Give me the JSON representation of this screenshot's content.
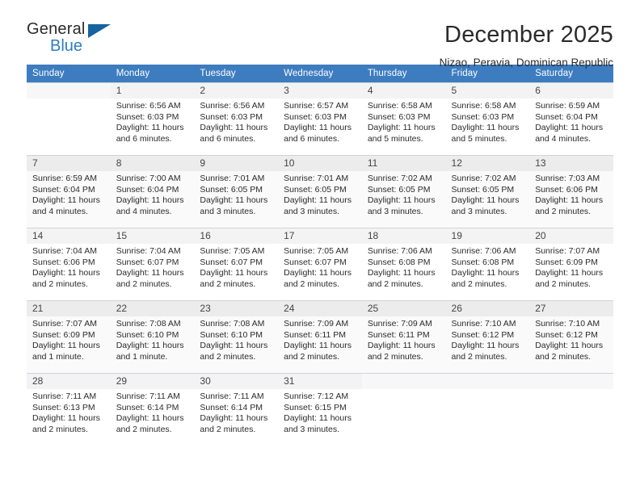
{
  "logo": {
    "word_top": "General",
    "word_bottom": "Blue",
    "triangle_color": "#15639f",
    "blue_color": "#2b7dc3"
  },
  "header": {
    "title": "December 2025",
    "location": "Nizao, Peravia, Dominican Republic"
  },
  "colors": {
    "header_row_bg": "#3d7cbf",
    "header_row_text": "#ffffff",
    "daynum_bg": "#f0f0f0",
    "grid_line": "#c8d4e2",
    "text": "#2b2b2b"
  },
  "weekday_headers": [
    "Sunday",
    "Monday",
    "Tuesday",
    "Wednesday",
    "Thursday",
    "Friday",
    "Saturday"
  ],
  "weeks": [
    {
      "days": [
        {
          "num": "",
          "sunrise": "",
          "sunset": "",
          "daylight_line1": "",
          "daylight_line2": ""
        },
        {
          "num": "1",
          "sunrise": "Sunrise: 6:56 AM",
          "sunset": "Sunset: 6:03 PM",
          "daylight_line1": "Daylight: 11 hours",
          "daylight_line2": "and 6 minutes."
        },
        {
          "num": "2",
          "sunrise": "Sunrise: 6:56 AM",
          "sunset": "Sunset: 6:03 PM",
          "daylight_line1": "Daylight: 11 hours",
          "daylight_line2": "and 6 minutes."
        },
        {
          "num": "3",
          "sunrise": "Sunrise: 6:57 AM",
          "sunset": "Sunset: 6:03 PM",
          "daylight_line1": "Daylight: 11 hours",
          "daylight_line2": "and 6 minutes."
        },
        {
          "num": "4",
          "sunrise": "Sunrise: 6:58 AM",
          "sunset": "Sunset: 6:03 PM",
          "daylight_line1": "Daylight: 11 hours",
          "daylight_line2": "and 5 minutes."
        },
        {
          "num": "5",
          "sunrise": "Sunrise: 6:58 AM",
          "sunset": "Sunset: 6:03 PM",
          "daylight_line1": "Daylight: 11 hours",
          "daylight_line2": "and 5 minutes."
        },
        {
          "num": "6",
          "sunrise": "Sunrise: 6:59 AM",
          "sunset": "Sunset: 6:04 PM",
          "daylight_line1": "Daylight: 11 hours",
          "daylight_line2": "and 4 minutes."
        }
      ]
    },
    {
      "days": [
        {
          "num": "7",
          "sunrise": "Sunrise: 6:59 AM",
          "sunset": "Sunset: 6:04 PM",
          "daylight_line1": "Daylight: 11 hours",
          "daylight_line2": "and 4 minutes."
        },
        {
          "num": "8",
          "sunrise": "Sunrise: 7:00 AM",
          "sunset": "Sunset: 6:04 PM",
          "daylight_line1": "Daylight: 11 hours",
          "daylight_line2": "and 4 minutes."
        },
        {
          "num": "9",
          "sunrise": "Sunrise: 7:01 AM",
          "sunset": "Sunset: 6:05 PM",
          "daylight_line1": "Daylight: 11 hours",
          "daylight_line2": "and 3 minutes."
        },
        {
          "num": "10",
          "sunrise": "Sunrise: 7:01 AM",
          "sunset": "Sunset: 6:05 PM",
          "daylight_line1": "Daylight: 11 hours",
          "daylight_line2": "and 3 minutes."
        },
        {
          "num": "11",
          "sunrise": "Sunrise: 7:02 AM",
          "sunset": "Sunset: 6:05 PM",
          "daylight_line1": "Daylight: 11 hours",
          "daylight_line2": "and 3 minutes."
        },
        {
          "num": "12",
          "sunrise": "Sunrise: 7:02 AM",
          "sunset": "Sunset: 6:05 PM",
          "daylight_line1": "Daylight: 11 hours",
          "daylight_line2": "and 3 minutes."
        },
        {
          "num": "13",
          "sunrise": "Sunrise: 7:03 AM",
          "sunset": "Sunset: 6:06 PM",
          "daylight_line1": "Daylight: 11 hours",
          "daylight_line2": "and 2 minutes."
        }
      ]
    },
    {
      "days": [
        {
          "num": "14",
          "sunrise": "Sunrise: 7:04 AM",
          "sunset": "Sunset: 6:06 PM",
          "daylight_line1": "Daylight: 11 hours",
          "daylight_line2": "and 2 minutes."
        },
        {
          "num": "15",
          "sunrise": "Sunrise: 7:04 AM",
          "sunset": "Sunset: 6:07 PM",
          "daylight_line1": "Daylight: 11 hours",
          "daylight_line2": "and 2 minutes."
        },
        {
          "num": "16",
          "sunrise": "Sunrise: 7:05 AM",
          "sunset": "Sunset: 6:07 PM",
          "daylight_line1": "Daylight: 11 hours",
          "daylight_line2": "and 2 minutes."
        },
        {
          "num": "17",
          "sunrise": "Sunrise: 7:05 AM",
          "sunset": "Sunset: 6:07 PM",
          "daylight_line1": "Daylight: 11 hours",
          "daylight_line2": "and 2 minutes."
        },
        {
          "num": "18",
          "sunrise": "Sunrise: 7:06 AM",
          "sunset": "Sunset: 6:08 PM",
          "daylight_line1": "Daylight: 11 hours",
          "daylight_line2": "and 2 minutes."
        },
        {
          "num": "19",
          "sunrise": "Sunrise: 7:06 AM",
          "sunset": "Sunset: 6:08 PM",
          "daylight_line1": "Daylight: 11 hours",
          "daylight_line2": "and 2 minutes."
        },
        {
          "num": "20",
          "sunrise": "Sunrise: 7:07 AM",
          "sunset": "Sunset: 6:09 PM",
          "daylight_line1": "Daylight: 11 hours",
          "daylight_line2": "and 2 minutes."
        }
      ]
    },
    {
      "days": [
        {
          "num": "21",
          "sunrise": "Sunrise: 7:07 AM",
          "sunset": "Sunset: 6:09 PM",
          "daylight_line1": "Daylight: 11 hours",
          "daylight_line2": "and 1 minute."
        },
        {
          "num": "22",
          "sunrise": "Sunrise: 7:08 AM",
          "sunset": "Sunset: 6:10 PM",
          "daylight_line1": "Daylight: 11 hours",
          "daylight_line2": "and 1 minute."
        },
        {
          "num": "23",
          "sunrise": "Sunrise: 7:08 AM",
          "sunset": "Sunset: 6:10 PM",
          "daylight_line1": "Daylight: 11 hours",
          "daylight_line2": "and 2 minutes."
        },
        {
          "num": "24",
          "sunrise": "Sunrise: 7:09 AM",
          "sunset": "Sunset: 6:11 PM",
          "daylight_line1": "Daylight: 11 hours",
          "daylight_line2": "and 2 minutes."
        },
        {
          "num": "25",
          "sunrise": "Sunrise: 7:09 AM",
          "sunset": "Sunset: 6:11 PM",
          "daylight_line1": "Daylight: 11 hours",
          "daylight_line2": "and 2 minutes."
        },
        {
          "num": "26",
          "sunrise": "Sunrise: 7:10 AM",
          "sunset": "Sunset: 6:12 PM",
          "daylight_line1": "Daylight: 11 hours",
          "daylight_line2": "and 2 minutes."
        },
        {
          "num": "27",
          "sunrise": "Sunrise: 7:10 AM",
          "sunset": "Sunset: 6:12 PM",
          "daylight_line1": "Daylight: 11 hours",
          "daylight_line2": "and 2 minutes."
        }
      ]
    },
    {
      "days": [
        {
          "num": "28",
          "sunrise": "Sunrise: 7:11 AM",
          "sunset": "Sunset: 6:13 PM",
          "daylight_line1": "Daylight: 11 hours",
          "daylight_line2": "and 2 minutes."
        },
        {
          "num": "29",
          "sunrise": "Sunrise: 7:11 AM",
          "sunset": "Sunset: 6:14 PM",
          "daylight_line1": "Daylight: 11 hours",
          "daylight_line2": "and 2 minutes."
        },
        {
          "num": "30",
          "sunrise": "Sunrise: 7:11 AM",
          "sunset": "Sunset: 6:14 PM",
          "daylight_line1": "Daylight: 11 hours",
          "daylight_line2": "and 2 minutes."
        },
        {
          "num": "31",
          "sunrise": "Sunrise: 7:12 AM",
          "sunset": "Sunset: 6:15 PM",
          "daylight_line1": "Daylight: 11 hours",
          "daylight_line2": "and 3 minutes."
        },
        {
          "num": "",
          "sunrise": "",
          "sunset": "",
          "daylight_line1": "",
          "daylight_line2": ""
        },
        {
          "num": "",
          "sunrise": "",
          "sunset": "",
          "daylight_line1": "",
          "daylight_line2": ""
        },
        {
          "num": "",
          "sunrise": "",
          "sunset": "",
          "daylight_line1": "",
          "daylight_line2": ""
        }
      ]
    }
  ]
}
